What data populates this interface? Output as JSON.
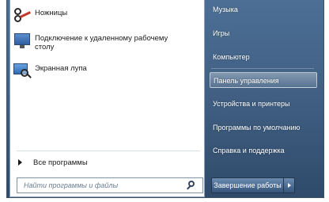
{
  "left_panel": {
    "programs": [
      {
        "label": "Ножницы",
        "icon": "scissors-icon"
      },
      {
        "label": "Подключение к удаленному рабочему столу",
        "icon": "remote-desktop-icon"
      },
      {
        "label": "Экранная лупа",
        "icon": "magnifier-icon"
      }
    ],
    "all_programs_label": "Все программы"
  },
  "search": {
    "placeholder": "Найти программы и файлы"
  },
  "right_panel": {
    "items": [
      {
        "label": "Музыка"
      },
      {
        "label": "Игры"
      },
      {
        "label": "Компьютер"
      },
      {
        "label": "Панель управления",
        "selected": true
      },
      {
        "label": "Устройства и принтеры"
      },
      {
        "label": "Программы по умолчанию"
      },
      {
        "label": "Справка и поддержка"
      }
    ],
    "shutdown_label": "Завершение работы"
  },
  "colors": {
    "panel_blue": "#3e5d80",
    "left_panel_bg": "#ffffff"
  }
}
